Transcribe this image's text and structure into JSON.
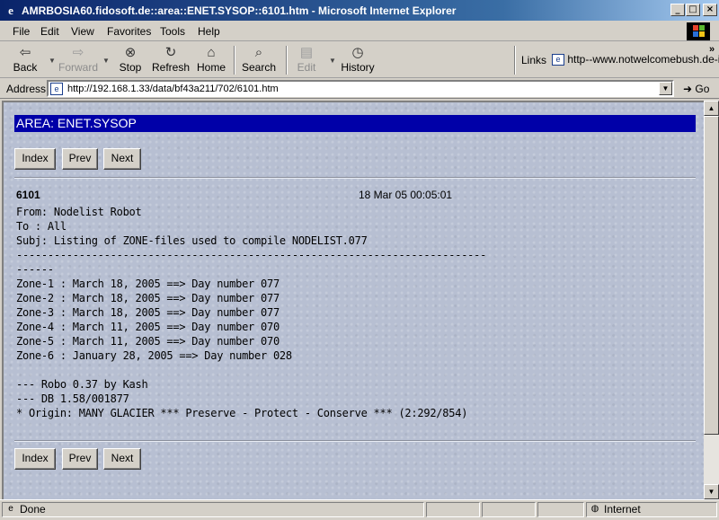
{
  "window": {
    "title": "AMRBOSIA60.fidosoft.de::area::ENET.SYSOP::6101.htm - Microsoft Internet Explorer"
  },
  "menu": [
    "File",
    "Edit",
    "View",
    "Favorites",
    "Tools",
    "Help"
  ],
  "toolbar": {
    "back": "Back",
    "forward": "Forward",
    "stop": "Stop",
    "refresh": "Refresh",
    "home": "Home",
    "search": "Search",
    "edit": "Edit",
    "history": "History"
  },
  "links": {
    "label": "Links",
    "item": "http--www.notwelcomebush.de-i"
  },
  "address": {
    "label": "Address",
    "url": "http://192.168.1.33/data/bf43a211/702/6101.htm",
    "go": "Go"
  },
  "page": {
    "area": "AREA: ENET.SYSOP",
    "nav": {
      "index": "Index",
      "prev": "Prev",
      "next": "Next"
    },
    "message": {
      "number": "6101",
      "date": "18 Mar 05 00:05:01",
      "lines": [
        "From: Nodelist Robot",
        "To : All",
        "Subj: Listing of ZONE-files used to compile NODELIST.077",
        "---------------------------------------------------------------------------",
        "------",
        "Zone-1 : March 18, 2005 ==> Day number 077",
        "Zone-2 : March 18, 2005 ==> Day number 077",
        "Zone-3 : March 18, 2005 ==> Day number 077",
        "Zone-4 : March 11, 2005 ==> Day number 070",
        "Zone-5 : March 11, 2005 ==> Day number 070",
        "Zone-6 : January 28, 2005 ==> Day number 028",
        "",
        "--- Robo 0.37 by Kash",
        "--- DB 1.58/001877",
        "* Origin: MANY GLACIER *** Preserve - Protect - Conserve *** (2:292/854)"
      ]
    }
  },
  "status": {
    "text": "Done",
    "zone": "Internet"
  },
  "colors": {
    "area_bar": "#0000a8",
    "page_bg": "#b7bfd2",
    "titlebar": "#0a246a"
  }
}
